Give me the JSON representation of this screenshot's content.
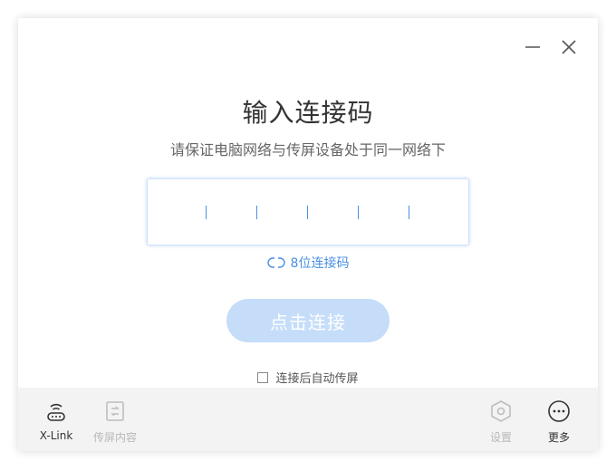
{
  "window": {
    "title": "输入连接码",
    "subtitle": "请保证电脑网络与传屏设备处于同一网络下"
  },
  "code_input": {
    "slots": 6,
    "value": ""
  },
  "switch_link": {
    "label": "8位连接码"
  },
  "connect_button": {
    "label": "点击连接"
  },
  "auto_share": {
    "label": "连接后自动传屏",
    "checked": false
  },
  "toolbar": {
    "xlink": {
      "label": "X-Link",
      "icon": "wifi-router-icon"
    },
    "content": {
      "label": "传屏内容",
      "icon": "screen-content-icon",
      "enabled": false
    },
    "settings": {
      "label": "设置",
      "icon": "hexagon-gear-icon",
      "enabled": false
    },
    "more": {
      "label": "更多",
      "icon": "more-dots-icon"
    }
  },
  "colors": {
    "accent": "#4a90e2",
    "button_disabled": "#c5ddf9",
    "toolbar_bg": "#f3f3f3"
  }
}
